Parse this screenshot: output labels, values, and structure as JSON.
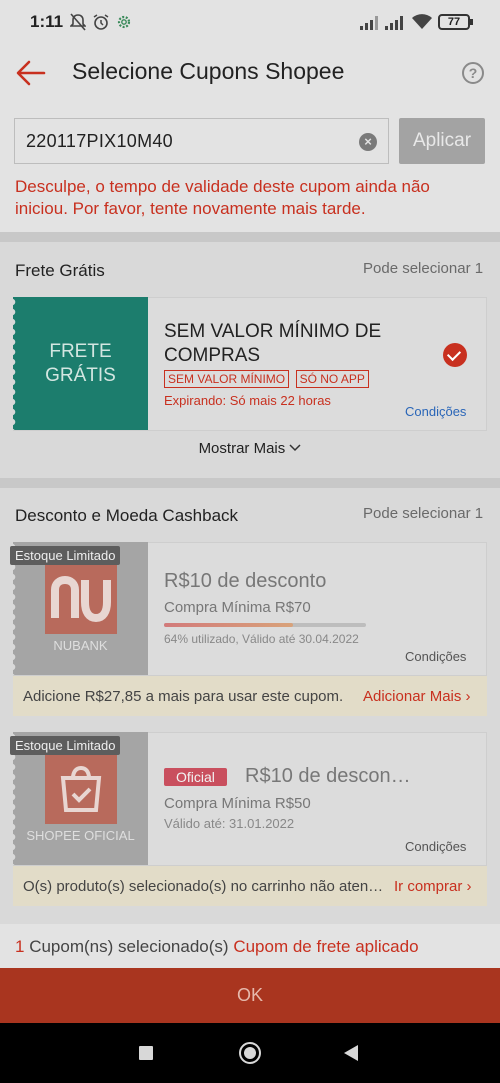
{
  "status_bar": {
    "time": "1:11",
    "battery": "77"
  },
  "header": {
    "title": "Selecione Cupons Shopee",
    "help": "?"
  },
  "code_entry": {
    "value": "220117PIX10M40",
    "apply_label": "Aplicar",
    "error": "Desculpe, o tempo de validade deste cupom ainda não iniciou. Por favor, tente novamente mais tarde."
  },
  "frete_section": {
    "title": "Frete Grátis",
    "hint": "Pode selecionar 1",
    "coupon": {
      "badge_line1": "FRETE",
      "badge_line2": "GRÁTIS",
      "title": "SEM VALOR MÍNIMO DE COMPRAS",
      "tags": [
        "SEM VALOR MÍNIMO",
        "SÓ NO APP"
      ],
      "expiry": "Expirando: Só mais 22 horas",
      "conditions": "Condições",
      "selected": true
    },
    "show_more": "Mostrar Mais"
  },
  "cashback_section": {
    "title": "Desconto e Moeda Cashback",
    "hint": "Pode selecionar 1",
    "coupons": [
      {
        "stock_tag": "Estoque Limitado",
        "logo_text": "nu",
        "brand": "NUBANK",
        "title": "R$10 de desconto",
        "min": "Compra Mínima R$70",
        "usage": "64% utilizado, Válido até 30.04.2022",
        "usage_percent": 64,
        "conditions": "Condições",
        "banner_text": "Adicione R$27,85 a mais para usar este cupom.",
        "banner_link": "Adicionar Mais"
      },
      {
        "stock_tag": "Estoque Limitado",
        "brand": "SHOPEE OFICIAL",
        "official_tag": "Oficial",
        "title": "R$10 de descon…",
        "min": "Compra Mínima R$50",
        "usage": "Válido até: 31.01.2022",
        "conditions": "Condições",
        "banner_text": "O(s) produto(s) selecionado(s) no carrinho não aten…",
        "banner_link": "Ir comprar"
      }
    ]
  },
  "footer": {
    "count": "1",
    "count_text": "Cupom(ns) selecionado(s)",
    "applied_text": "Cupom de frete aplicado",
    "ok_label": "OK"
  },
  "colors": {
    "accent": "#c8301f",
    "frete_teal": "#1c7d6d",
    "overlay_grey": "#d9d9d9"
  }
}
